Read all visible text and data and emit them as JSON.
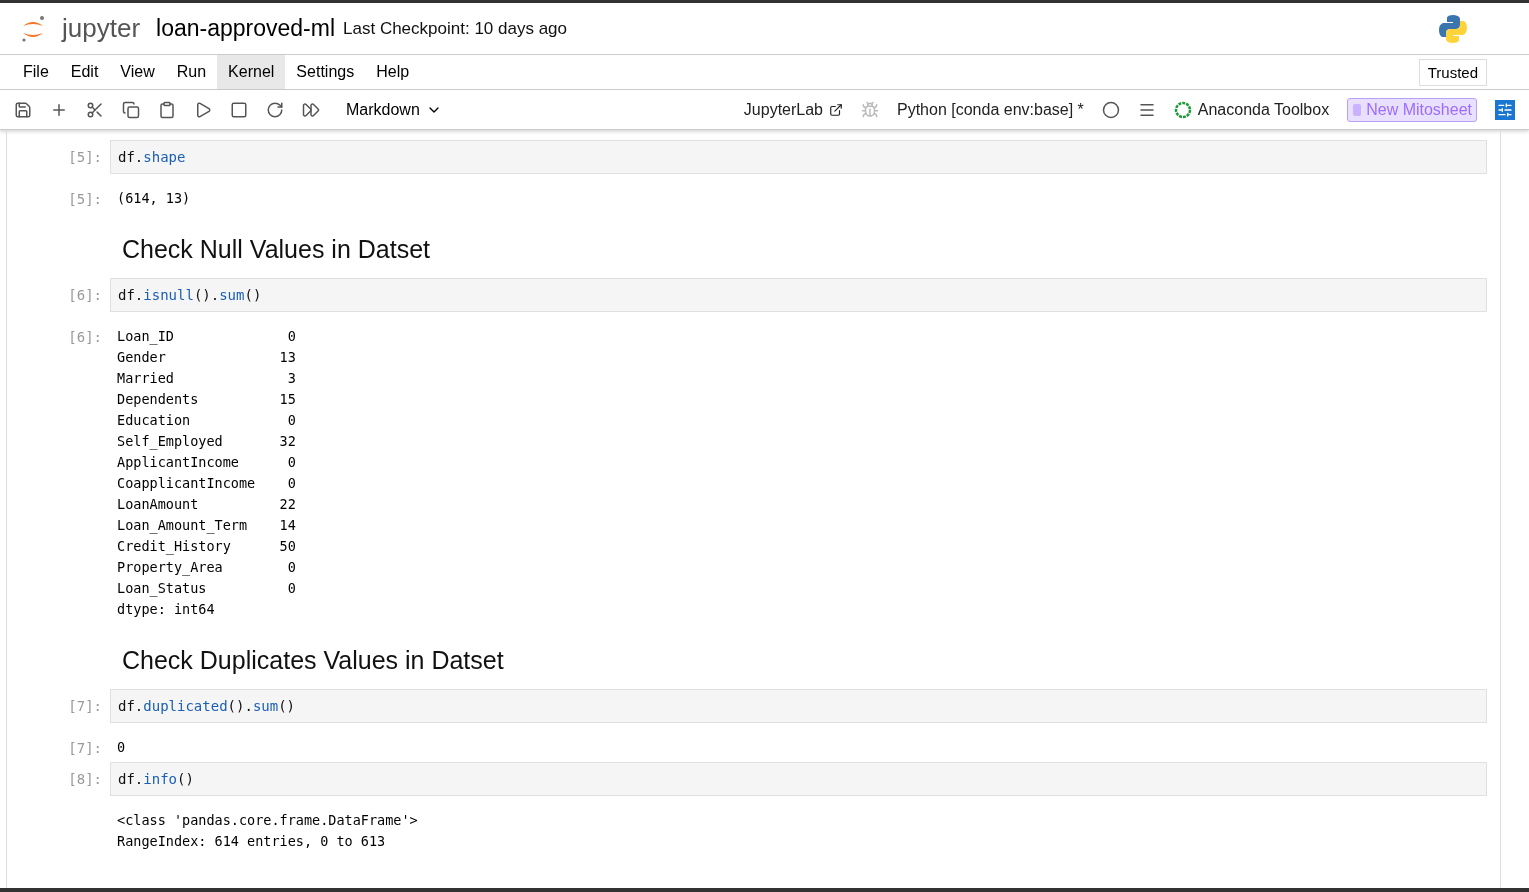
{
  "header": {
    "logo_text": "jupyter",
    "notebook_name": "loan-approved-ml",
    "checkpoint": "Last Checkpoint: 10 days ago"
  },
  "menu": [
    {
      "label": "File",
      "selected": false
    },
    {
      "label": "Edit",
      "selected": false
    },
    {
      "label": "View",
      "selected": false
    },
    {
      "label": "Run",
      "selected": false
    },
    {
      "label": "Kernel",
      "selected": true
    },
    {
      "label": "Settings",
      "selected": false
    },
    {
      "label": "Help",
      "selected": false
    }
  ],
  "trusted": "Trusted",
  "toolbar": {
    "cell_type": "Markdown",
    "jupyterlab": "JupyterLab",
    "kernel": "Python [conda env:base] *",
    "anaconda": "Anaconda Toolbox",
    "mitosheet": "New Mitosheet"
  },
  "cells": [
    {
      "kind": "code",
      "prompt": "[5]:",
      "code": [
        {
          "text": "df.",
          "kind": "plain"
        },
        {
          "text": "shape",
          "kind": "attr"
        }
      ]
    },
    {
      "kind": "output",
      "prompt": "[5]:",
      "lines": [
        "(614, 13)"
      ]
    },
    {
      "kind": "heading",
      "text": "Check Null Values in Datset"
    },
    {
      "kind": "code",
      "prompt": "[6]:",
      "code": [
        {
          "text": "df.",
          "kind": "plain"
        },
        {
          "text": "isnull",
          "kind": "attr"
        },
        {
          "text": "().",
          "kind": "plain"
        },
        {
          "text": "sum",
          "kind": "attr"
        },
        {
          "text": "()",
          "kind": "plain"
        }
      ]
    },
    {
      "kind": "output",
      "prompt": "[6]:",
      "lines": [
        "Loan_ID              0",
        "Gender              13",
        "Married              3",
        "Dependents          15",
        "Education            0",
        "Self_Employed       32",
        "ApplicantIncome      0",
        "CoapplicantIncome    0",
        "LoanAmount          22",
        "Loan_Amount_Term    14",
        "Credit_History      50",
        "Property_Area        0",
        "Loan_Status          0",
        "dtype: int64"
      ]
    },
    {
      "kind": "heading",
      "text": "Check Duplicates Values in Datset"
    },
    {
      "kind": "code",
      "prompt": "[7]:",
      "code": [
        {
          "text": "df.",
          "kind": "plain"
        },
        {
          "text": "duplicated",
          "kind": "attr"
        },
        {
          "text": "().",
          "kind": "plain"
        },
        {
          "text": "sum",
          "kind": "attr"
        },
        {
          "text": "()",
          "kind": "plain"
        }
      ]
    },
    {
      "kind": "output",
      "prompt": "[7]:",
      "lines": [
        "0"
      ]
    },
    {
      "kind": "code",
      "prompt": "[8]:",
      "code": [
        {
          "text": "df.",
          "kind": "plain"
        },
        {
          "text": "info",
          "kind": "attr"
        },
        {
          "text": "()",
          "kind": "plain"
        }
      ]
    },
    {
      "kind": "output",
      "lines": [
        "<class 'pandas.core.frame.DataFrame'>",
        "RangeIndex: 614 entries, 0 to 613"
      ]
    }
  ]
}
